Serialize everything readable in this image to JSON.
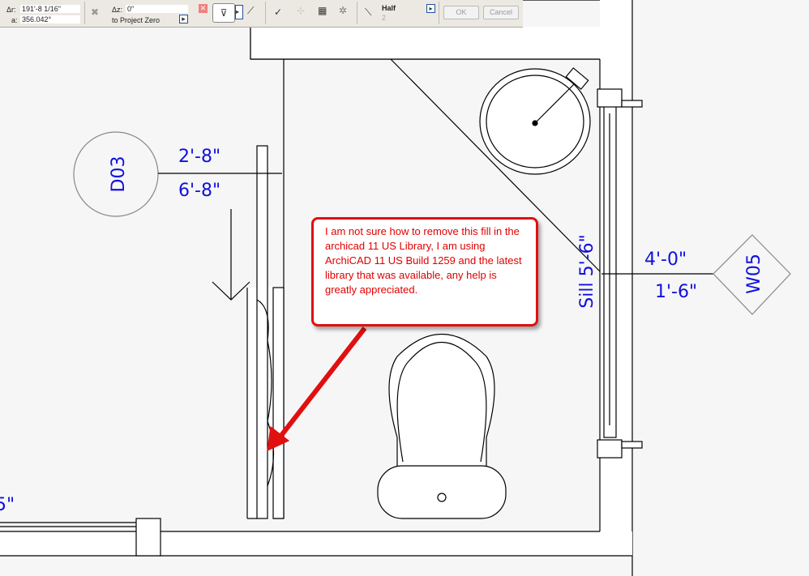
{
  "toolbar": {
    "delta_r_label": "Δr:",
    "delta_r_value": "191'-8 1/16\"",
    "angle_label": "a:",
    "angle_value": "356.042°",
    "delta_z_label": "Δz:",
    "delta_z_value": "0\"",
    "reference": "to Project Zero",
    "pen_label": "Half",
    "pen_number": "2",
    "ok_label": "OK",
    "cancel_label": "Cancel"
  },
  "plan": {
    "door_tag": "D03",
    "door_width": "2'-8\"",
    "door_height": "6'-8\"",
    "window_tag": "W05",
    "window_width": "4'-0\"",
    "window_height": "1'-6\"",
    "window_sill": "Sill 5'-6\"",
    "partial_dim": "5\""
  },
  "callout": {
    "text": "I am not sure how to remove this fill in the archicad 11 US Library, I am using ArchiCAD 11 US Build 1259 and the latest library that was available, any help is greatly appreciated.",
    "color": "#e00000"
  }
}
